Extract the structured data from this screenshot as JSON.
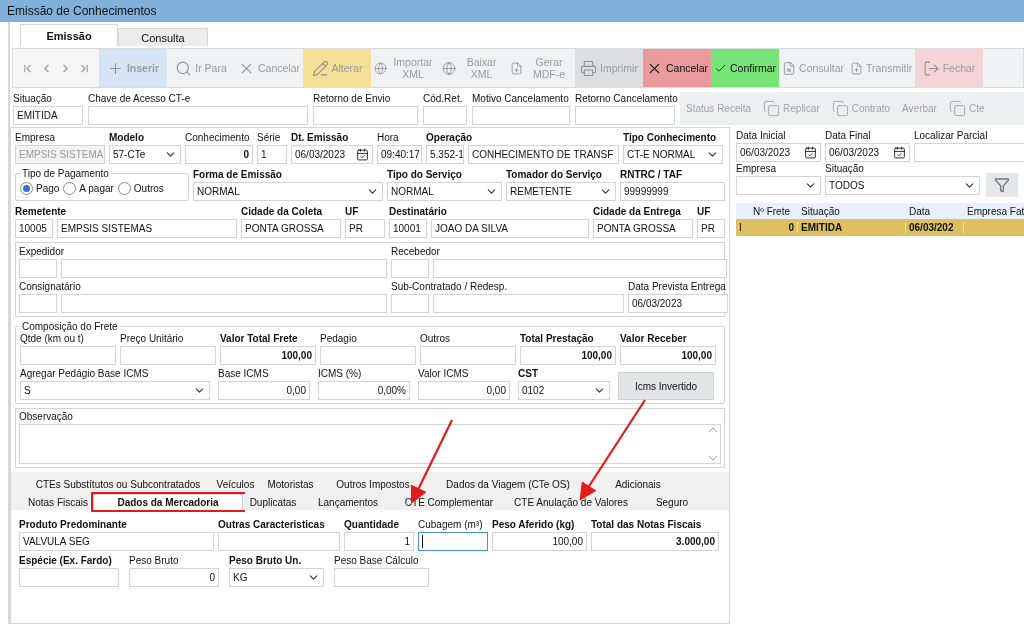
{
  "window": {
    "title": "Emissão de Conhecimentos"
  },
  "tabs": [
    {
      "label": "Emissão",
      "selected": true
    },
    {
      "label": "Consulta",
      "selected": false
    }
  ],
  "toolbar": {
    "buttons": [
      {
        "label": "Inserir",
        "disabled": true,
        "color": "#d5e5f5"
      },
      {
        "label": "Ir Para",
        "disabled": true
      },
      {
        "label": "Cancelar",
        "disabled": true
      },
      {
        "label": "Alterar",
        "disabled": true,
        "color": "#f5df97"
      },
      {
        "label": "Importar XML",
        "disabled": true
      },
      {
        "label": "Baixar XML",
        "disabled": true
      },
      {
        "label": "Gerar MDF-e",
        "disabled": true
      },
      {
        "label": "Imprimir",
        "disabled": true,
        "color": "#dcdee2"
      },
      {
        "label": "Cancelar",
        "disabled": false,
        "color": "#e99a9a"
      },
      {
        "label": "Confirmar",
        "disabled": false,
        "color": "#77e477"
      },
      {
        "label": "Consultar",
        "disabled": true
      },
      {
        "label": "Transmitir",
        "disabled": true
      },
      {
        "label": "Fechar",
        "disabled": true,
        "color": "#f4d4d6"
      }
    ]
  },
  "status": {
    "fields": [
      {
        "label": "Situação",
        "kind": "text",
        "value": "EMITIDA",
        "emphasis": false
      },
      {
        "label": "Chave de Acesso CT-e",
        "kind": "text",
        "emphasis": false
      },
      {
        "label": "Retorno de Envio",
        "kind": "text",
        "emphasis": false
      },
      {
        "label": "Cód.Ret.",
        "kind": "text",
        "emphasis": false
      },
      {
        "label": "Motivo Cancelamento",
        "kind": "text",
        "emphasis": false
      },
      {
        "label": "Retorno Cancelamento",
        "kind": "text",
        "emphasis": false
      }
    ],
    "actions": [
      {
        "label": "Status Receita",
        "disabled": true
      },
      {
        "label": "Replicar",
        "disabled": true
      },
      {
        "label": "Contrato",
        "disabled": true
      },
      {
        "label": "Averbar",
        "disabled": true
      },
      {
        "label": "Cte",
        "disabled": true
      }
    ]
  },
  "form": {
    "fields": [
      {
        "label": "Empresa",
        "kind": "select",
        "value": "EMPSIS SISTEMA",
        "emphasis": false,
        "disabled": true
      },
      {
        "label": "Modelo",
        "kind": "select",
        "value": "57-CTe",
        "emphasis": true
      },
      {
        "label": "Conhecimento",
        "kind": "text",
        "value": "0",
        "emphasis": false,
        "numeric": true,
        "highlight": true
      },
      {
        "label": "Série",
        "kind": "text",
        "value": "1",
        "emphasis": false
      },
      {
        "label": "Dt. Emissão",
        "kind": "date",
        "value": "06/03/2023",
        "emphasis": true
      },
      {
        "label": "Hora",
        "kind": "text",
        "value": "09:40:17",
        "emphasis": false
      },
      {
        "label": "Operação",
        "kind": "code-name",
        "code": "5.352-1",
        "value": "CONHECIMENTO DE TRANSF",
        "emphasis": true
      },
      {
        "label": "Tipo Conhecimento",
        "kind": "select",
        "value": "CT-E NORMAL",
        "emphasis": true
      },
      {
        "label": "Tipo de Pagamento",
        "kind": "radio-group",
        "options": [
          {
            "label": "Pago",
            "selected": true
          },
          {
            "label": "A pagar",
            "selected": false
          },
          {
            "label": "Outros",
            "selected": false
          }
        ]
      },
      {
        "label": "Forma de Emissão",
        "kind": "select",
        "value": "NORMAL",
        "emphasis": true
      },
      {
        "label": "Tipo do Serviço",
        "kind": "select",
        "value": "NORMAL",
        "emphasis": true
      },
      {
        "label": "Tomador do Serviço",
        "kind": "select",
        "value": "REMETENTE",
        "emphasis": true
      },
      {
        "label": "RNTRC / TAF",
        "kind": "text",
        "value": "99999999",
        "emphasis": true
      },
      {
        "label": "Remetente",
        "kind": "code-name",
        "code": "10005",
        "value": "EMPSIS SISTEMAS",
        "emphasis": true
      },
      {
        "label": "Cidade da Coleta",
        "kind": "text",
        "value": "PONTA GROSSA",
        "emphasis": true
      },
      {
        "label": "UF",
        "kind": "text",
        "value": "PR",
        "emphasis": true
      },
      {
        "label": "Destinatário",
        "kind": "code-name",
        "code": "10001",
        "value": "JOAO DA SILVA",
        "emphasis": true
      },
      {
        "label": "Cidade da Entrega",
        "kind": "text",
        "value": "PONTA GROSSA",
        "emphasis": true
      },
      {
        "label": "UF",
        "kind": "text",
        "value": "PR",
        "emphasis": true
      }
    ]
  },
  "parties": {
    "fields": [
      {
        "label": "Expedidor",
        "kind": "code-name",
        "emphasis": false
      },
      {
        "label": "Recebedor",
        "kind": "code-name",
        "emphasis": false
      },
      {
        "label": "Consignatário",
        "kind": "code-name",
        "emphasis": false
      },
      {
        "label": "Sub-Contratado / Redesp.",
        "kind": "code-name",
        "emphasis": false
      },
      {
        "label": "Data Prevista Entrega",
        "kind": "text",
        "value": "06/03/2023",
        "emphasis": false
      }
    ]
  },
  "freight": {
    "title": "Composição do Frete",
    "fields": [
      {
        "label": "Qtde (km ou t)",
        "kind": "text",
        "emphasis": false
      },
      {
        "label": "Preço Unitário",
        "kind": "text",
        "emphasis": false
      },
      {
        "label": "Valor Total Frete",
        "kind": "text",
        "value": "100,00",
        "emphasis": true,
        "numeric": true,
        "highlight": true
      },
      {
        "label": "Pedagio",
        "kind": "text",
        "emphasis": false
      },
      {
        "label": "Outros",
        "kind": "text",
        "emphasis": false
      },
      {
        "label": "Total Prestação",
        "kind": "text",
        "value": "100,00",
        "emphasis": true,
        "numeric": true,
        "highlight": true
      },
      {
        "label": "Valor Receber",
        "kind": "text",
        "value": "100,00",
        "emphasis": true,
        "numeric": true,
        "highlight": true
      },
      {
        "label": "Agregar Pedágio Base ICMS",
        "kind": "select",
        "value": "S",
        "emphasis": false
      },
      {
        "label": "Base ICMS",
        "kind": "text",
        "value": "0,00",
        "emphasis": false,
        "numeric": true
      },
      {
        "label": "ICMS (%)",
        "kind": "text",
        "value": "0,00%",
        "emphasis": false,
        "numeric": true
      },
      {
        "label": "Valor ICMS",
        "kind": "text",
        "value": "0,00",
        "emphasis": false,
        "numeric": true
      },
      {
        "label": "CST",
        "kind": "select",
        "value": "0102",
        "emphasis": true
      },
      {
        "label": "Icms Invertido",
        "kind": "button"
      }
    ]
  },
  "notes": {
    "label": "Observação"
  },
  "detail_tabs": {
    "back_row": [
      {
        "label": "CTEs Substítutos ou Subcontratados",
        "selected": false,
        "highlighted": false
      },
      {
        "label": "Veículos",
        "selected": false,
        "highlighted": false
      },
      {
        "label": "Motoristas",
        "selected": false,
        "highlighted": false
      },
      {
        "label": "Outros Impostos",
        "selected": false,
        "highlighted": false
      },
      {
        "label": "Dados da Viagem (CTe OS)",
        "selected": false,
        "highlighted": false
      },
      {
        "label": "Adicionais",
        "selected": false,
        "highlighted": false
      }
    ],
    "front_row": [
      {
        "label": "Notas Fiscais",
        "selected": false,
        "highlighted": false
      },
      {
        "label": "Dados da Mercadoria",
        "selected": true,
        "highlighted": true
      },
      {
        "label": "Duplicatas",
        "selected": false,
        "highlighted": false
      },
      {
        "label": "Lançamentos",
        "selected": false,
        "highlighted": false
      },
      {
        "label": "CTE Complementar",
        "selected": false,
        "highlighted": false
      },
      {
        "label": "CTE Anulação de Valores",
        "selected": false,
        "highlighted": false
      },
      {
        "label": "Seguro",
        "selected": false,
        "highlighted": false
      }
    ]
  },
  "merchandise": {
    "fields": [
      {
        "label": "Produto Predominante",
        "kind": "text",
        "value": "VALVULA SEG",
        "emphasis": true
      },
      {
        "label": "Outras Caracteristicas",
        "kind": "text",
        "emphasis": true
      },
      {
        "label": "Quantidade",
        "kind": "text",
        "value": "1",
        "emphasis": true,
        "numeric": true
      },
      {
        "label": "Cubagem (m³)",
        "kind": "text",
        "emphasis": false,
        "focused": true
      },
      {
        "label": "Peso Aferido (kg)",
        "kind": "text",
        "value": "100,00",
        "emphasis": true,
        "numeric": true
      },
      {
        "label": "Total das Notas Fiscais",
        "kind": "text",
        "value": "3.000,00",
        "emphasis": true,
        "numeric": true,
        "highlight": true
      },
      {
        "label": "Espécie (Ex. Fardo)",
        "kind": "text",
        "emphasis": true
      },
      {
        "label": "Peso Bruto",
        "kind": "text",
        "value": "0",
        "emphasis": false,
        "numeric": true
      },
      {
        "label": "Peso Bruto Un.",
        "kind": "select",
        "value": "KG",
        "emphasis": true
      },
      {
        "label": "Peso Base Cálculo",
        "kind": "text",
        "emphasis": false
      }
    ]
  },
  "search": {
    "fields": [
      {
        "label": "Data Inicial",
        "kind": "date",
        "value": "06/03/2023",
        "emphasis": false
      },
      {
        "label": "Data Final",
        "kind": "date",
        "value": "06/03/2023",
        "emphasis": false
      },
      {
        "label": "Localizar Parcial",
        "kind": "text",
        "emphasis": false
      },
      {
        "label": "Empresa",
        "kind": "select",
        "emphasis": false
      },
      {
        "label": "Situação",
        "kind": "select",
        "value": "TODOS",
        "emphasis": false
      }
    ]
  },
  "results": {
    "columns": [
      "Nº Frete",
      "Situação",
      "Data",
      "Empresa Fat"
    ],
    "rows": [
      {
        "indicator": "I",
        "cells": [
          "0",
          "EMITIDA",
          "06/03/202"
        ],
        "selected": true
      }
    ]
  },
  "annotations": [
    {
      "kind": "arrow"
    },
    {
      "kind": "arrow"
    }
  ]
}
